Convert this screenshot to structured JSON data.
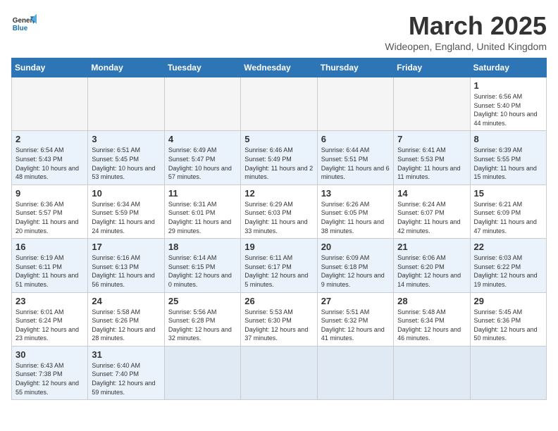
{
  "header": {
    "logo_general": "General",
    "logo_blue": "Blue",
    "month_title": "March 2025",
    "location": "Wideopen, England, United Kingdom"
  },
  "weekdays": [
    "Sunday",
    "Monday",
    "Tuesday",
    "Wednesday",
    "Thursday",
    "Friday",
    "Saturday"
  ],
  "weeks": [
    [
      {
        "day": "",
        "info": ""
      },
      {
        "day": "",
        "info": ""
      },
      {
        "day": "",
        "info": ""
      },
      {
        "day": "",
        "info": ""
      },
      {
        "day": "",
        "info": ""
      },
      {
        "day": "",
        "info": ""
      },
      {
        "day": "1",
        "info": "Sunrise: 6:56 AM\nSunset: 5:40 PM\nDaylight: 10 hours and 44 minutes."
      }
    ],
    [
      {
        "day": "2",
        "info": "Sunrise: 6:54 AM\nSunset: 5:43 PM\nDaylight: 10 hours and 48 minutes."
      },
      {
        "day": "3",
        "info": "Sunrise: 6:51 AM\nSunset: 5:45 PM\nDaylight: 10 hours and 53 minutes."
      },
      {
        "day": "4",
        "info": "Sunrise: 6:49 AM\nSunset: 5:47 PM\nDaylight: 10 hours and 57 minutes."
      },
      {
        "day": "5",
        "info": "Sunrise: 6:46 AM\nSunset: 5:49 PM\nDaylight: 11 hours and 2 minutes."
      },
      {
        "day": "6",
        "info": "Sunrise: 6:44 AM\nSunset: 5:51 PM\nDaylight: 11 hours and 6 minutes."
      },
      {
        "day": "7",
        "info": "Sunrise: 6:41 AM\nSunset: 5:53 PM\nDaylight: 11 hours and 11 minutes."
      },
      {
        "day": "8",
        "info": "Sunrise: 6:39 AM\nSunset: 5:55 PM\nDaylight: 11 hours and 15 minutes."
      }
    ],
    [
      {
        "day": "9",
        "info": "Sunrise: 6:36 AM\nSunset: 5:57 PM\nDaylight: 11 hours and 20 minutes."
      },
      {
        "day": "10",
        "info": "Sunrise: 6:34 AM\nSunset: 5:59 PM\nDaylight: 11 hours and 24 minutes."
      },
      {
        "day": "11",
        "info": "Sunrise: 6:31 AM\nSunset: 6:01 PM\nDaylight: 11 hours and 29 minutes."
      },
      {
        "day": "12",
        "info": "Sunrise: 6:29 AM\nSunset: 6:03 PM\nDaylight: 11 hours and 33 minutes."
      },
      {
        "day": "13",
        "info": "Sunrise: 6:26 AM\nSunset: 6:05 PM\nDaylight: 11 hours and 38 minutes."
      },
      {
        "day": "14",
        "info": "Sunrise: 6:24 AM\nSunset: 6:07 PM\nDaylight: 11 hours and 42 minutes."
      },
      {
        "day": "15",
        "info": "Sunrise: 6:21 AM\nSunset: 6:09 PM\nDaylight: 11 hours and 47 minutes."
      }
    ],
    [
      {
        "day": "16",
        "info": "Sunrise: 6:19 AM\nSunset: 6:11 PM\nDaylight: 11 hours and 51 minutes."
      },
      {
        "day": "17",
        "info": "Sunrise: 6:16 AM\nSunset: 6:13 PM\nDaylight: 11 hours and 56 minutes."
      },
      {
        "day": "18",
        "info": "Sunrise: 6:14 AM\nSunset: 6:15 PM\nDaylight: 12 hours and 0 minutes."
      },
      {
        "day": "19",
        "info": "Sunrise: 6:11 AM\nSunset: 6:17 PM\nDaylight: 12 hours and 5 minutes."
      },
      {
        "day": "20",
        "info": "Sunrise: 6:09 AM\nSunset: 6:18 PM\nDaylight: 12 hours and 9 minutes."
      },
      {
        "day": "21",
        "info": "Sunrise: 6:06 AM\nSunset: 6:20 PM\nDaylight: 12 hours and 14 minutes."
      },
      {
        "day": "22",
        "info": "Sunrise: 6:03 AM\nSunset: 6:22 PM\nDaylight: 12 hours and 19 minutes."
      }
    ],
    [
      {
        "day": "23",
        "info": "Sunrise: 6:01 AM\nSunset: 6:24 PM\nDaylight: 12 hours and 23 minutes."
      },
      {
        "day": "24",
        "info": "Sunrise: 5:58 AM\nSunset: 6:26 PM\nDaylight: 12 hours and 28 minutes."
      },
      {
        "day": "25",
        "info": "Sunrise: 5:56 AM\nSunset: 6:28 PM\nDaylight: 12 hours and 32 minutes."
      },
      {
        "day": "26",
        "info": "Sunrise: 5:53 AM\nSunset: 6:30 PM\nDaylight: 12 hours and 37 minutes."
      },
      {
        "day": "27",
        "info": "Sunrise: 5:51 AM\nSunset: 6:32 PM\nDaylight: 12 hours and 41 minutes."
      },
      {
        "day": "28",
        "info": "Sunrise: 5:48 AM\nSunset: 6:34 PM\nDaylight: 12 hours and 46 minutes."
      },
      {
        "day": "29",
        "info": "Sunrise: 5:45 AM\nSunset: 6:36 PM\nDaylight: 12 hours and 50 minutes."
      }
    ],
    [
      {
        "day": "30",
        "info": "Sunrise: 6:43 AM\nSunset: 7:38 PM\nDaylight: 12 hours and 55 minutes."
      },
      {
        "day": "31",
        "info": "Sunrise: 6:40 AM\nSunset: 7:40 PM\nDaylight: 12 hours and 59 minutes."
      },
      {
        "day": "",
        "info": ""
      },
      {
        "day": "",
        "info": ""
      },
      {
        "day": "",
        "info": ""
      },
      {
        "day": "",
        "info": ""
      },
      {
        "day": "",
        "info": ""
      }
    ]
  ]
}
